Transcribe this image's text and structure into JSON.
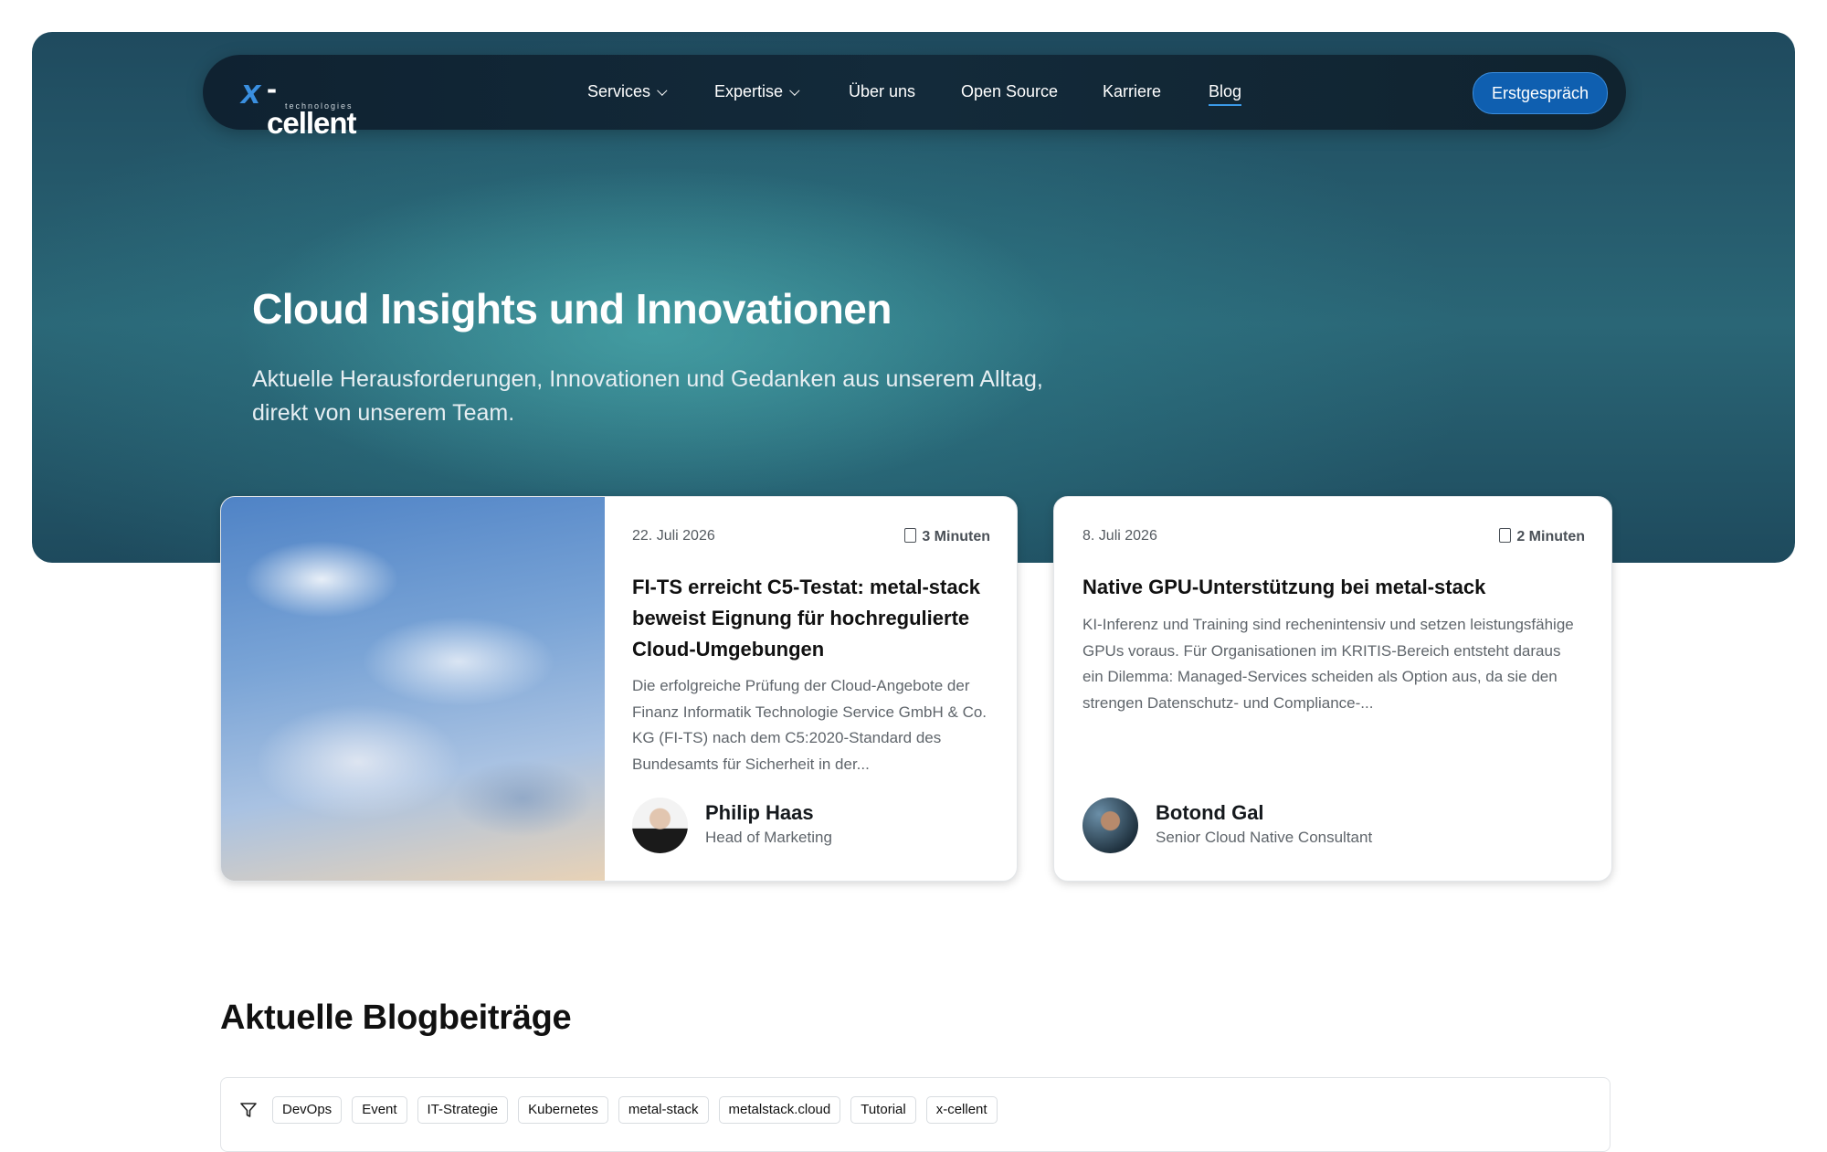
{
  "nav": {
    "logo_text": "x-cellent",
    "logo_sub": "technologies",
    "items": [
      {
        "label": "Services"
      },
      {
        "label": "Expertise"
      },
      {
        "label": "Über uns"
      },
      {
        "label": "Open Source"
      },
      {
        "label": "Karriere"
      },
      {
        "label": "Blog"
      }
    ],
    "cta": "Erstgespräch"
  },
  "hero": {
    "title": "Cloud Insights und Innovationen",
    "subtitle": "Aktuelle Herausforderungen, Innovationen und Gedanken aus unserem Alltag, direkt von unserem Team."
  },
  "featured": [
    {
      "date": "22. Juli 2026",
      "read_time": "3 Minuten",
      "title": "FI-TS erreicht C5-Testat: metal-stack beweist Eignung für hochregulierte Cloud-Umgebungen",
      "excerpt": "Die erfolgreiche Prüfung der Cloud-Angebote der Finanz Informatik Technologie Service GmbH & Co. KG (FI-TS) nach dem C5:2020-Standard des Bundesamts für Sicherheit in der...",
      "author": {
        "name": "Philip Haas",
        "role": "Head of Marketing"
      }
    },
    {
      "date": "8. Juli 2026",
      "read_time": "2 Minuten",
      "title": "Native GPU-Unterstützung bei metal-stack",
      "excerpt": "KI-Inferenz und Training sind rechenintensiv und setzen leistungsfähige GPUs voraus. Für Organisationen im KRITIS-Bereich entsteht daraus ein Dilemma: Managed-Services scheiden als Option aus, da sie den strengen Datenschutz- und Compliance-...",
      "author": {
        "name": "Botond Gal",
        "role": "Senior Cloud Native Consultant"
      }
    }
  ],
  "blog": {
    "heading": "Aktuelle Blogbeiträge",
    "tags": [
      "DevOps",
      "Event",
      "IT-Strategie",
      "Kubernetes",
      "metal-stack",
      "metalstack.cloud",
      "Tutorial",
      "x-cellent"
    ]
  }
}
